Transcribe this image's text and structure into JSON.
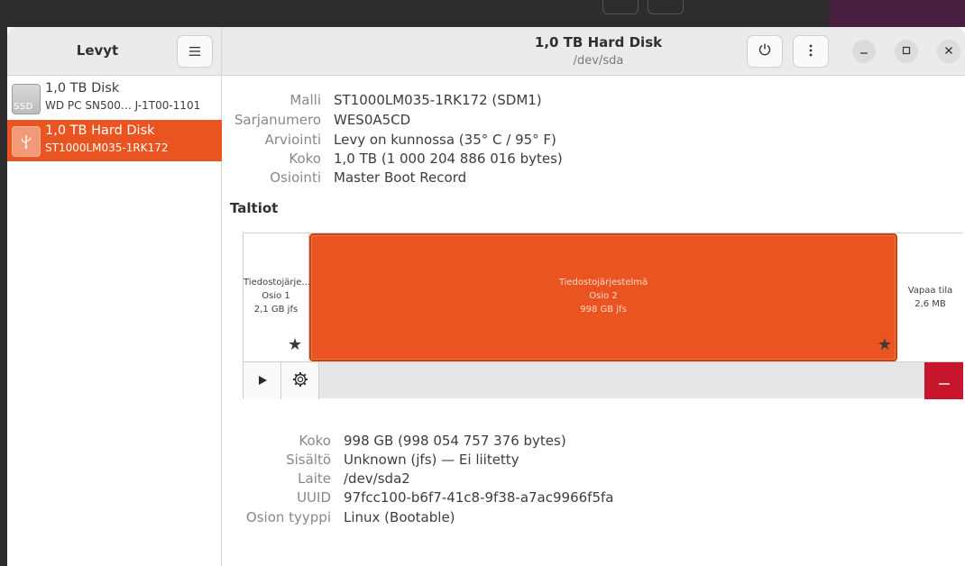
{
  "sidebar": {
    "title": "Levyt",
    "drives": [
      {
        "name": "1,0 TB Disk",
        "sub": "WD PC SN500… J-1T00-1101",
        "badge": "SSD"
      },
      {
        "name": "1,0 TB Hard Disk",
        "sub": "ST1000LM035-1RK172"
      }
    ]
  },
  "header": {
    "title": "1,0 TB Hard Disk",
    "subtitle": "/dev/sda"
  },
  "disk_info": [
    {
      "key": "Malli",
      "value": "ST1000LM035-1RK172 (SDM1)"
    },
    {
      "key": "Sarjanumero",
      "value": "WES0A5CD"
    },
    {
      "key": "Arviointi",
      "value": "Levy on kunnossa (35° C / 95° F)"
    },
    {
      "key": "Koko",
      "value": "1,0 TB (1 000 204 886 016 bytes)"
    },
    {
      "key": "Osiointi",
      "value": "Master Boot Record"
    }
  ],
  "volumes": {
    "title": "Taltiot",
    "partitions": [
      {
        "line1": "Tiedostojärje…",
        "line2": "Osio 1",
        "line3": "2,1 GB jfs"
      },
      {
        "line1": "Tiedostojärjestelmä",
        "line2": "Osio 2",
        "line3": "998 GB jfs"
      },
      {
        "line1": "Vapaa tila",
        "line2": "2,6 MB"
      }
    ]
  },
  "partition_info": [
    {
      "key": "Koko",
      "value": "998 GB (998 054 757 376 bytes)"
    },
    {
      "key": "Sisältö",
      "value": "Unknown (jfs) — Ei liitetty"
    },
    {
      "key": "Laite",
      "value": "/dev/sda2"
    },
    {
      "key": "UUID",
      "value": "97fcc100-b6f7-41c8-9f38-a7ac9966f5fa"
    },
    {
      "key": "Osion tyyppi",
      "value": "Linux (Bootable)"
    }
  ],
  "colors": {
    "accent": "#e95420",
    "danger": "#c7162b"
  }
}
